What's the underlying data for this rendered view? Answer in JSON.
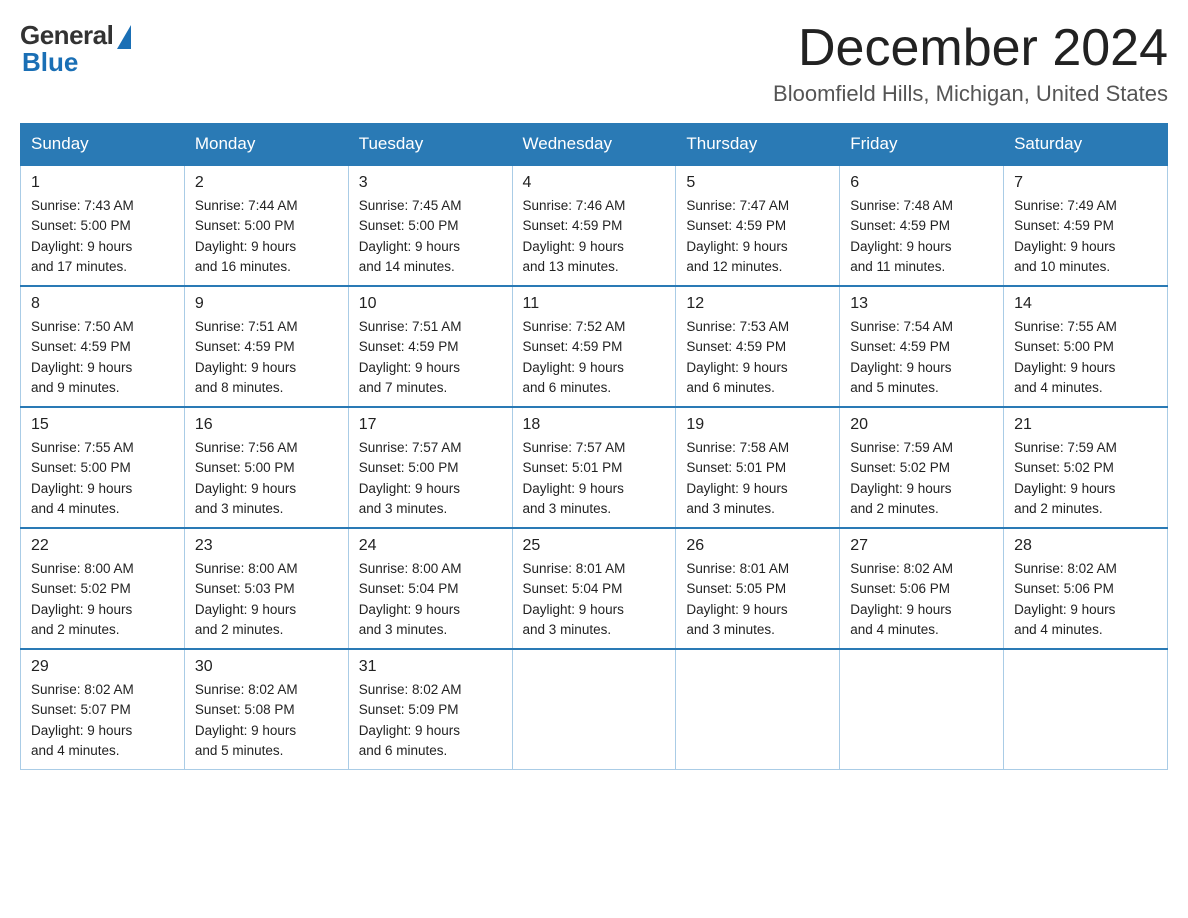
{
  "logo": {
    "general": "General",
    "blue": "Blue"
  },
  "header": {
    "month": "December 2024",
    "location": "Bloomfield Hills, Michigan, United States"
  },
  "days_of_week": [
    "Sunday",
    "Monday",
    "Tuesday",
    "Wednesday",
    "Thursday",
    "Friday",
    "Saturday"
  ],
  "weeks": [
    [
      {
        "day": "1",
        "sunrise": "7:43 AM",
        "sunset": "5:00 PM",
        "daylight": "9 hours and 17 minutes."
      },
      {
        "day": "2",
        "sunrise": "7:44 AM",
        "sunset": "5:00 PM",
        "daylight": "9 hours and 16 minutes."
      },
      {
        "day": "3",
        "sunrise": "7:45 AM",
        "sunset": "5:00 PM",
        "daylight": "9 hours and 14 minutes."
      },
      {
        "day": "4",
        "sunrise": "7:46 AM",
        "sunset": "4:59 PM",
        "daylight": "9 hours and 13 minutes."
      },
      {
        "day": "5",
        "sunrise": "7:47 AM",
        "sunset": "4:59 PM",
        "daylight": "9 hours and 12 minutes."
      },
      {
        "day": "6",
        "sunrise": "7:48 AM",
        "sunset": "4:59 PM",
        "daylight": "9 hours and 11 minutes."
      },
      {
        "day": "7",
        "sunrise": "7:49 AM",
        "sunset": "4:59 PM",
        "daylight": "9 hours and 10 minutes."
      }
    ],
    [
      {
        "day": "8",
        "sunrise": "7:50 AM",
        "sunset": "4:59 PM",
        "daylight": "9 hours and 9 minutes."
      },
      {
        "day": "9",
        "sunrise": "7:51 AM",
        "sunset": "4:59 PM",
        "daylight": "9 hours and 8 minutes."
      },
      {
        "day": "10",
        "sunrise": "7:51 AM",
        "sunset": "4:59 PM",
        "daylight": "9 hours and 7 minutes."
      },
      {
        "day": "11",
        "sunrise": "7:52 AM",
        "sunset": "4:59 PM",
        "daylight": "9 hours and 6 minutes."
      },
      {
        "day": "12",
        "sunrise": "7:53 AM",
        "sunset": "4:59 PM",
        "daylight": "9 hours and 6 minutes."
      },
      {
        "day": "13",
        "sunrise": "7:54 AM",
        "sunset": "4:59 PM",
        "daylight": "9 hours and 5 minutes."
      },
      {
        "day": "14",
        "sunrise": "7:55 AM",
        "sunset": "5:00 PM",
        "daylight": "9 hours and 4 minutes."
      }
    ],
    [
      {
        "day": "15",
        "sunrise": "7:55 AM",
        "sunset": "5:00 PM",
        "daylight": "9 hours and 4 minutes."
      },
      {
        "day": "16",
        "sunrise": "7:56 AM",
        "sunset": "5:00 PM",
        "daylight": "9 hours and 3 minutes."
      },
      {
        "day": "17",
        "sunrise": "7:57 AM",
        "sunset": "5:00 PM",
        "daylight": "9 hours and 3 minutes."
      },
      {
        "day": "18",
        "sunrise": "7:57 AM",
        "sunset": "5:01 PM",
        "daylight": "9 hours and 3 minutes."
      },
      {
        "day": "19",
        "sunrise": "7:58 AM",
        "sunset": "5:01 PM",
        "daylight": "9 hours and 3 minutes."
      },
      {
        "day": "20",
        "sunrise": "7:59 AM",
        "sunset": "5:02 PM",
        "daylight": "9 hours and 2 minutes."
      },
      {
        "day": "21",
        "sunrise": "7:59 AM",
        "sunset": "5:02 PM",
        "daylight": "9 hours and 2 minutes."
      }
    ],
    [
      {
        "day": "22",
        "sunrise": "8:00 AM",
        "sunset": "5:02 PM",
        "daylight": "9 hours and 2 minutes."
      },
      {
        "day": "23",
        "sunrise": "8:00 AM",
        "sunset": "5:03 PM",
        "daylight": "9 hours and 2 minutes."
      },
      {
        "day": "24",
        "sunrise": "8:00 AM",
        "sunset": "5:04 PM",
        "daylight": "9 hours and 3 minutes."
      },
      {
        "day": "25",
        "sunrise": "8:01 AM",
        "sunset": "5:04 PM",
        "daylight": "9 hours and 3 minutes."
      },
      {
        "day": "26",
        "sunrise": "8:01 AM",
        "sunset": "5:05 PM",
        "daylight": "9 hours and 3 minutes."
      },
      {
        "day": "27",
        "sunrise": "8:02 AM",
        "sunset": "5:06 PM",
        "daylight": "9 hours and 4 minutes."
      },
      {
        "day": "28",
        "sunrise": "8:02 AM",
        "sunset": "5:06 PM",
        "daylight": "9 hours and 4 minutes."
      }
    ],
    [
      {
        "day": "29",
        "sunrise": "8:02 AM",
        "sunset": "5:07 PM",
        "daylight": "9 hours and 4 minutes."
      },
      {
        "day": "30",
        "sunrise": "8:02 AM",
        "sunset": "5:08 PM",
        "daylight": "9 hours and 5 minutes."
      },
      {
        "day": "31",
        "sunrise": "8:02 AM",
        "sunset": "5:09 PM",
        "daylight": "9 hours and 6 minutes."
      },
      null,
      null,
      null,
      null
    ]
  ],
  "labels": {
    "sunrise": "Sunrise: ",
    "sunset": "Sunset: ",
    "daylight": "Daylight: "
  }
}
